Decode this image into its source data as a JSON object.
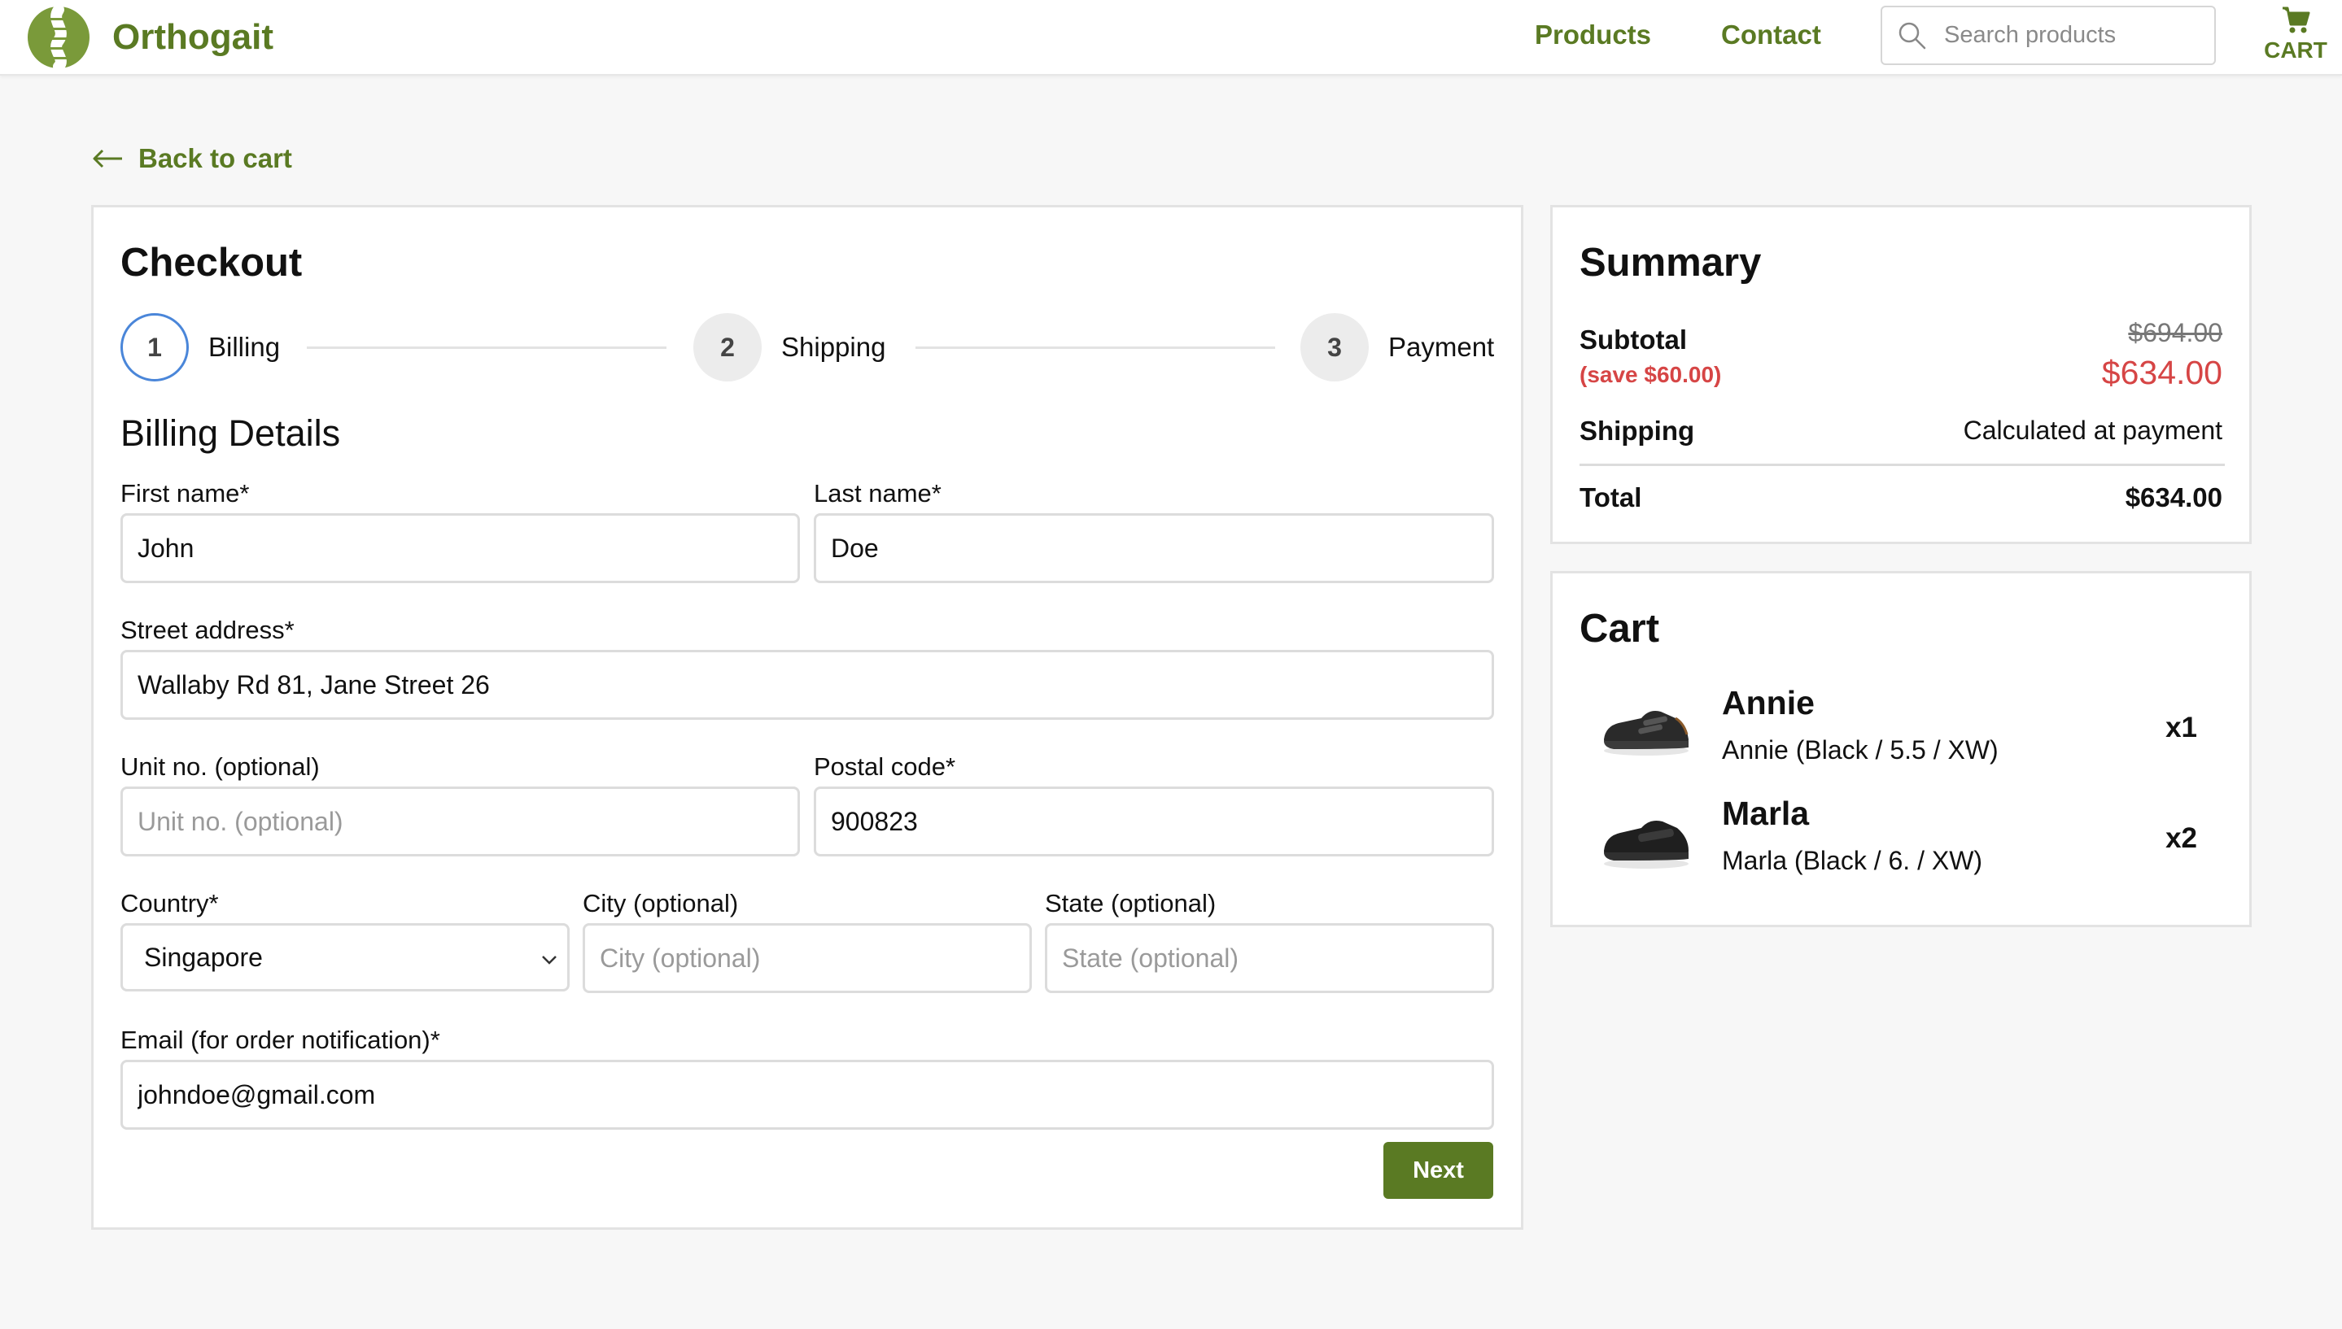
{
  "header": {
    "brand": "Orthogait",
    "nav": {
      "products": "Products",
      "contact": "Contact"
    },
    "search": {
      "placeholder": "Search products",
      "value": ""
    },
    "cart_label": "CART"
  },
  "back_link": "Back to cart",
  "checkout": {
    "title": "Checkout",
    "steps": [
      {
        "number": "1",
        "label": "Billing",
        "active": true
      },
      {
        "number": "2",
        "label": "Shipping",
        "active": false
      },
      {
        "number": "3",
        "label": "Payment",
        "active": false
      }
    ],
    "section_title": "Billing Details",
    "fields": {
      "first_name": {
        "label": "First name*",
        "value": "John",
        "placeholder": ""
      },
      "last_name": {
        "label": "Last name*",
        "value": "Doe",
        "placeholder": ""
      },
      "street": {
        "label": "Street address*",
        "value": "Wallaby Rd 81, Jane Street 26",
        "placeholder": ""
      },
      "unit": {
        "label": "Unit no. (optional)",
        "value": "",
        "placeholder": "Unit no. (optional)"
      },
      "postal": {
        "label": "Postal code*",
        "value": "900823",
        "placeholder": ""
      },
      "country": {
        "label": "Country*",
        "value": "Singapore"
      },
      "city": {
        "label": "City (optional)",
        "value": "",
        "placeholder": "City (optional)"
      },
      "state": {
        "label": "State (optional)",
        "value": "",
        "placeholder": "State (optional)"
      },
      "email": {
        "label": "Email (for order notification)*",
        "value": "johndoe@gmail.com",
        "placeholder": ""
      }
    },
    "next_button": "Next"
  },
  "summary": {
    "title": "Summary",
    "subtotal_label": "Subtotal",
    "savings": "(save $60.00)",
    "original_price": "$694.00",
    "discounted_price": "$634.00",
    "shipping_label": "Shipping",
    "shipping_value": "Calculated at payment",
    "total_label": "Total",
    "total_value": "$634.00"
  },
  "cart": {
    "title": "Cart",
    "items": [
      {
        "name": "Annie",
        "variant": "Annie (Black / 5.5 / XW)",
        "qty": "x1"
      },
      {
        "name": "Marla",
        "variant": "Marla (Black / 6. / XW)",
        "qty": "x2"
      }
    ]
  },
  "colors": {
    "brand_green": "#5a7a23",
    "sale_red": "#d64545",
    "active_step_blue": "#4a86d9"
  }
}
